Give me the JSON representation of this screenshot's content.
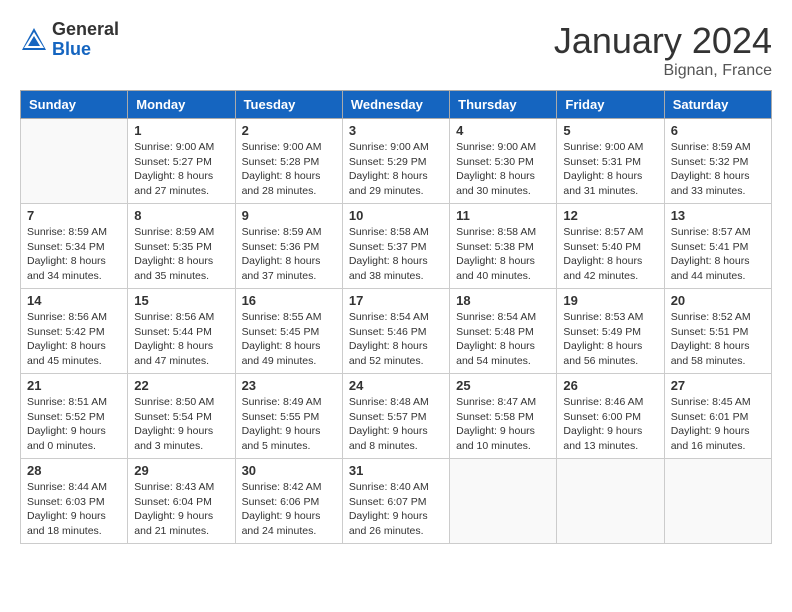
{
  "header": {
    "logo_general": "General",
    "logo_blue": "Blue",
    "month_title": "January 2024",
    "location": "Bignan, France"
  },
  "days_of_week": [
    "Sunday",
    "Monday",
    "Tuesday",
    "Wednesday",
    "Thursday",
    "Friday",
    "Saturday"
  ],
  "weeks": [
    [
      {
        "day": "",
        "info": ""
      },
      {
        "day": "1",
        "info": "Sunrise: 9:00 AM\nSunset: 5:27 PM\nDaylight: 8 hours\nand 27 minutes."
      },
      {
        "day": "2",
        "info": "Sunrise: 9:00 AM\nSunset: 5:28 PM\nDaylight: 8 hours\nand 28 minutes."
      },
      {
        "day": "3",
        "info": "Sunrise: 9:00 AM\nSunset: 5:29 PM\nDaylight: 8 hours\nand 29 minutes."
      },
      {
        "day": "4",
        "info": "Sunrise: 9:00 AM\nSunset: 5:30 PM\nDaylight: 8 hours\nand 30 minutes."
      },
      {
        "day": "5",
        "info": "Sunrise: 9:00 AM\nSunset: 5:31 PM\nDaylight: 8 hours\nand 31 minutes."
      },
      {
        "day": "6",
        "info": "Sunrise: 8:59 AM\nSunset: 5:32 PM\nDaylight: 8 hours\nand 33 minutes."
      }
    ],
    [
      {
        "day": "7",
        "info": "Sunrise: 8:59 AM\nSunset: 5:34 PM\nDaylight: 8 hours\nand 34 minutes."
      },
      {
        "day": "8",
        "info": "Sunrise: 8:59 AM\nSunset: 5:35 PM\nDaylight: 8 hours\nand 35 minutes."
      },
      {
        "day": "9",
        "info": "Sunrise: 8:59 AM\nSunset: 5:36 PM\nDaylight: 8 hours\nand 37 minutes."
      },
      {
        "day": "10",
        "info": "Sunrise: 8:58 AM\nSunset: 5:37 PM\nDaylight: 8 hours\nand 38 minutes."
      },
      {
        "day": "11",
        "info": "Sunrise: 8:58 AM\nSunset: 5:38 PM\nDaylight: 8 hours\nand 40 minutes."
      },
      {
        "day": "12",
        "info": "Sunrise: 8:57 AM\nSunset: 5:40 PM\nDaylight: 8 hours\nand 42 minutes."
      },
      {
        "day": "13",
        "info": "Sunrise: 8:57 AM\nSunset: 5:41 PM\nDaylight: 8 hours\nand 44 minutes."
      }
    ],
    [
      {
        "day": "14",
        "info": "Sunrise: 8:56 AM\nSunset: 5:42 PM\nDaylight: 8 hours\nand 45 minutes."
      },
      {
        "day": "15",
        "info": "Sunrise: 8:56 AM\nSunset: 5:44 PM\nDaylight: 8 hours\nand 47 minutes."
      },
      {
        "day": "16",
        "info": "Sunrise: 8:55 AM\nSunset: 5:45 PM\nDaylight: 8 hours\nand 49 minutes."
      },
      {
        "day": "17",
        "info": "Sunrise: 8:54 AM\nSunset: 5:46 PM\nDaylight: 8 hours\nand 52 minutes."
      },
      {
        "day": "18",
        "info": "Sunrise: 8:54 AM\nSunset: 5:48 PM\nDaylight: 8 hours\nand 54 minutes."
      },
      {
        "day": "19",
        "info": "Sunrise: 8:53 AM\nSunset: 5:49 PM\nDaylight: 8 hours\nand 56 minutes."
      },
      {
        "day": "20",
        "info": "Sunrise: 8:52 AM\nSunset: 5:51 PM\nDaylight: 8 hours\nand 58 minutes."
      }
    ],
    [
      {
        "day": "21",
        "info": "Sunrise: 8:51 AM\nSunset: 5:52 PM\nDaylight: 9 hours\nand 0 minutes."
      },
      {
        "day": "22",
        "info": "Sunrise: 8:50 AM\nSunset: 5:54 PM\nDaylight: 9 hours\nand 3 minutes."
      },
      {
        "day": "23",
        "info": "Sunrise: 8:49 AM\nSunset: 5:55 PM\nDaylight: 9 hours\nand 5 minutes."
      },
      {
        "day": "24",
        "info": "Sunrise: 8:48 AM\nSunset: 5:57 PM\nDaylight: 9 hours\nand 8 minutes."
      },
      {
        "day": "25",
        "info": "Sunrise: 8:47 AM\nSunset: 5:58 PM\nDaylight: 9 hours\nand 10 minutes."
      },
      {
        "day": "26",
        "info": "Sunrise: 8:46 AM\nSunset: 6:00 PM\nDaylight: 9 hours\nand 13 minutes."
      },
      {
        "day": "27",
        "info": "Sunrise: 8:45 AM\nSunset: 6:01 PM\nDaylight: 9 hours\nand 16 minutes."
      }
    ],
    [
      {
        "day": "28",
        "info": "Sunrise: 8:44 AM\nSunset: 6:03 PM\nDaylight: 9 hours\nand 18 minutes."
      },
      {
        "day": "29",
        "info": "Sunrise: 8:43 AM\nSunset: 6:04 PM\nDaylight: 9 hours\nand 21 minutes."
      },
      {
        "day": "30",
        "info": "Sunrise: 8:42 AM\nSunset: 6:06 PM\nDaylight: 9 hours\nand 24 minutes."
      },
      {
        "day": "31",
        "info": "Sunrise: 8:40 AM\nSunset: 6:07 PM\nDaylight: 9 hours\nand 26 minutes."
      },
      {
        "day": "",
        "info": ""
      },
      {
        "day": "",
        "info": ""
      },
      {
        "day": "",
        "info": ""
      }
    ]
  ]
}
